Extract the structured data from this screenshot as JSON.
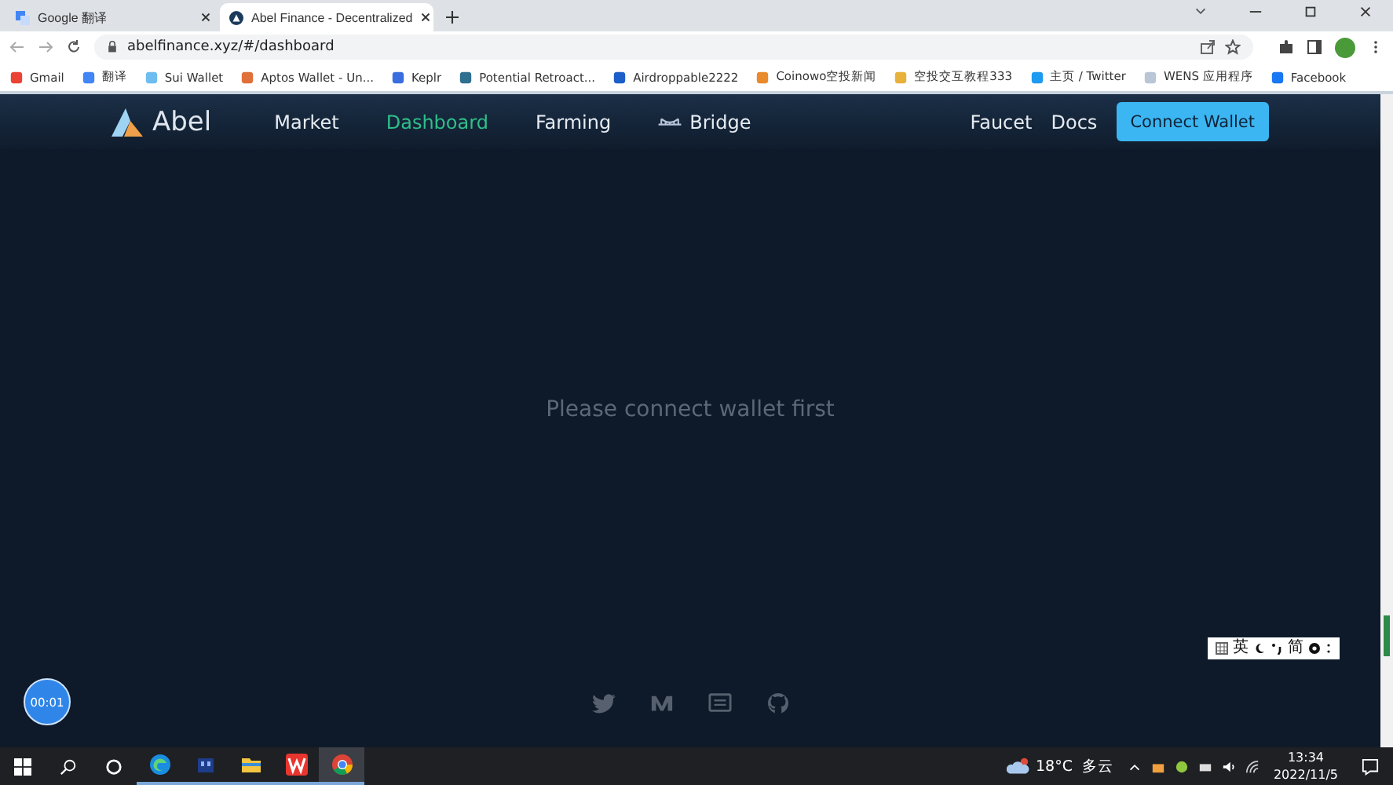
{
  "browser": {
    "tabs": [
      {
        "title": "Google 翻译",
        "selected": false,
        "kind": "translate"
      },
      {
        "title": "Abel Finance - Decentralized",
        "selected": true,
        "kind": "abel"
      }
    ],
    "address": "abelfinance.xyz/#/dashboard",
    "bookmarks": [
      {
        "label": "Gmail",
        "color": "#ea4335"
      },
      {
        "label": "翻译",
        "color": "#4285f4"
      },
      {
        "label": "Sui Wallet",
        "color": "#6fbcf0"
      },
      {
        "label": "Aptos Wallet - Un...",
        "color": "#e0703a"
      },
      {
        "label": "Keplr",
        "color": "#3a6de0"
      },
      {
        "label": "Potential Retroact...",
        "color": "#2f6f8f"
      },
      {
        "label": "Airdroppable2222",
        "color": "#1d5fc9"
      },
      {
        "label": "Coinowo空投新闻",
        "color": "#e98a2c"
      },
      {
        "label": "空投交互教程333",
        "color": "#e8b13a"
      },
      {
        "label": "主页 / Twitter",
        "color": "#1d9bf0"
      },
      {
        "label": "WENS 应用程序",
        "color": "#b9c6d6"
      },
      {
        "label": "Facebook",
        "color": "#1877f2"
      }
    ]
  },
  "nav": {
    "logo": "Abel",
    "links": [
      {
        "label": "Market",
        "selected": false
      },
      {
        "label": "Dashboard",
        "selected": true
      },
      {
        "label": "Farming",
        "selected": false
      },
      {
        "label": "Bridge",
        "selected": false,
        "kind": "bridge"
      }
    ],
    "right_links": [
      "Faucet",
      "Docs"
    ],
    "button": "Connect Wallet"
  },
  "message": "Please connect wallet first",
  "timer": "00:01",
  "ime": {
    "mode": "英",
    "script": "简"
  },
  "taskbar": {
    "apps": [
      {
        "kind": "edge",
        "selected": false
      },
      {
        "kind": "app",
        "selected": false
      },
      {
        "kind": "files",
        "selected": false
      },
      {
        "kind": "wps",
        "selected": false
      },
      {
        "kind": "chrome",
        "selected": true
      }
    ],
    "temperature": "18°C",
    "weather": "多云",
    "time": "13:34",
    "date": "2022/11/5"
  }
}
